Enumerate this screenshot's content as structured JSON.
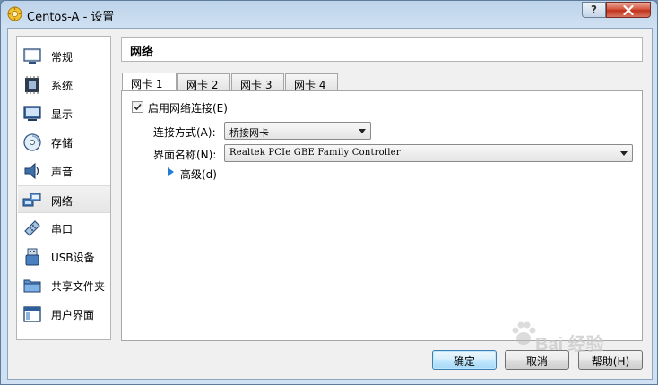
{
  "window": {
    "title": "Centos-A - 设置",
    "help_label": "?"
  },
  "sidebar": {
    "items": [
      {
        "label": "常规",
        "icon": "monitor-general-icon"
      },
      {
        "label": "系统",
        "icon": "chip-system-icon"
      },
      {
        "label": "显示",
        "icon": "display-icon"
      },
      {
        "label": "存储",
        "icon": "storage-disc-icon"
      },
      {
        "label": "声音",
        "icon": "speaker-icon"
      },
      {
        "label": "网络",
        "icon": "network-icon",
        "selected": true
      },
      {
        "label": "串口",
        "icon": "serial-port-icon"
      },
      {
        "label": "USB设备",
        "icon": "usb-icon"
      },
      {
        "label": "共享文件夹",
        "icon": "shared-folder-icon"
      },
      {
        "label": "用户界面",
        "icon": "user-interface-icon"
      }
    ]
  },
  "page": {
    "title": "网络"
  },
  "tabs": [
    {
      "label": "网卡 1",
      "active": true
    },
    {
      "label": "网卡 2"
    },
    {
      "label": "网卡 3"
    },
    {
      "label": "网卡 4"
    }
  ],
  "adapter": {
    "enable_label": "启用网络连接(E)",
    "enable_checked": true,
    "attached_label": "连接方式(A):",
    "attached_value": "桥接网卡",
    "name_label": "界面名称(N):",
    "name_value": "Realtek PCIe GBE Family Controller",
    "advanced_label": "高级(d)"
  },
  "buttons": {
    "ok": "确定",
    "cancel": "取消",
    "help": "帮助(H)"
  },
  "watermark": {
    "text": "Bai 经验"
  },
  "colors": {
    "accent": "#3c7fb1",
    "close_button": "#c1321d",
    "expand_arrow": "#1f7fd6"
  }
}
